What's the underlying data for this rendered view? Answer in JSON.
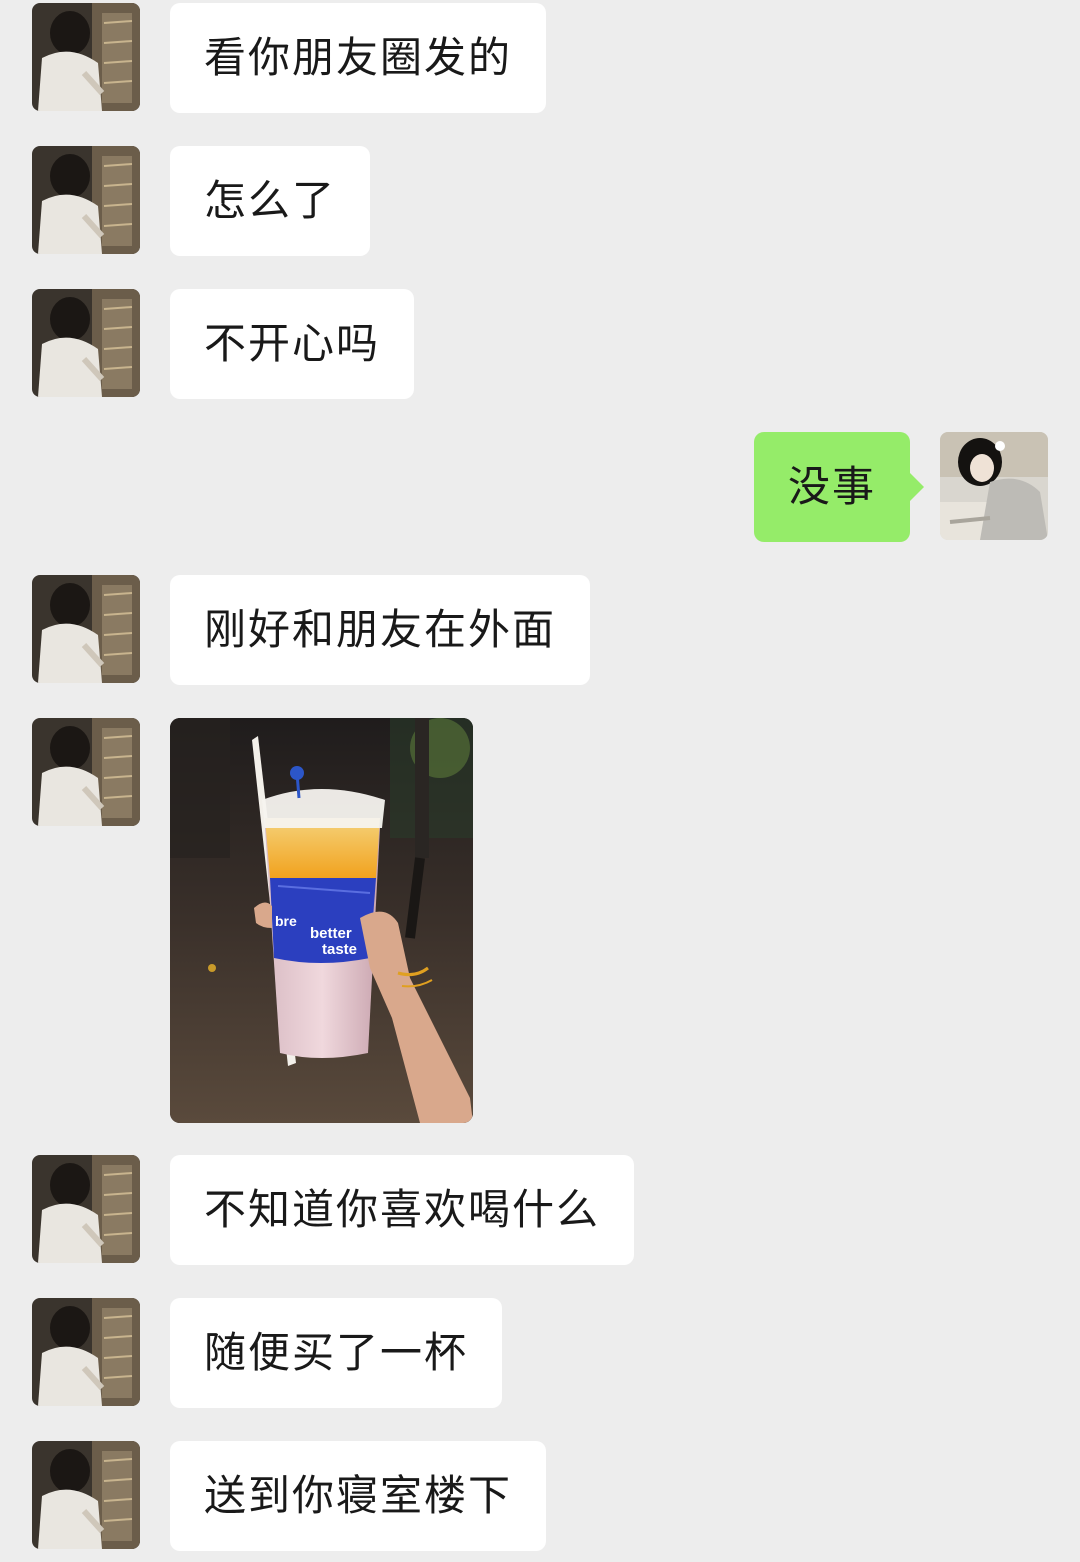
{
  "messages": [
    {
      "side": "left",
      "text": "看你朋友圈发的"
    },
    {
      "side": "left",
      "text": "怎么了"
    },
    {
      "side": "left",
      "text": "不开心吗"
    },
    {
      "side": "right",
      "text": "没事"
    },
    {
      "side": "left",
      "text": "刚好和朋友在外面"
    },
    {
      "side": "left",
      "type": "image",
      "image_text": [
        "better",
        "taste",
        "bre"
      ]
    },
    {
      "side": "left",
      "text": "不知道你喜欢喝什么"
    },
    {
      "side": "left",
      "text": "随便买了一杯"
    },
    {
      "side": "left",
      "text": "送到你寝室楼下"
    }
  ],
  "colors": {
    "background": "#ededed",
    "bubble_incoming": "#ffffff",
    "bubble_outgoing": "#95ec69",
    "text": "#191919"
  },
  "icons": {
    "contact_avatar": "contact-avatar",
    "user_avatar": "user-avatar"
  }
}
